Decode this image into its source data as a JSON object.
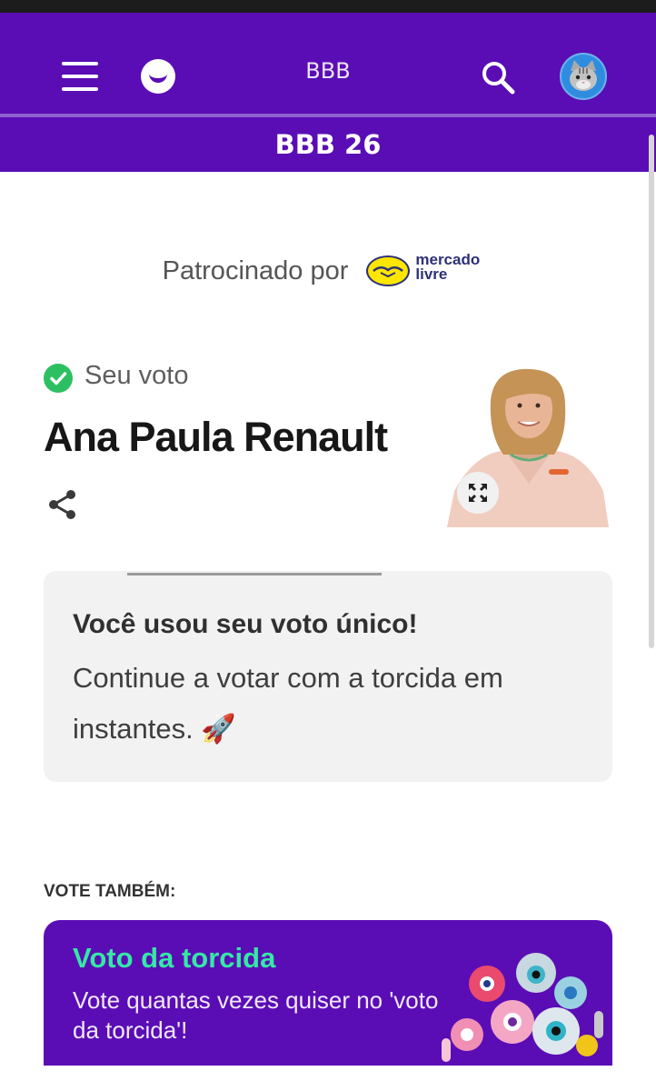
{
  "header": {
    "title": "BBB",
    "section_title": "BBB 26"
  },
  "sponsor": {
    "label": "Patrocinado por",
    "brand_line1": "mercado",
    "brand_line2": "livre"
  },
  "vote": {
    "status_label": "Seu voto",
    "candidate_name": "Ana Paula Renault"
  },
  "notice": {
    "title": "Você usou seu voto único!",
    "body": "Continue a votar com a torcida em instantes. 🚀"
  },
  "vote_also": {
    "heading": "VOTE TAMBÉM:",
    "card_title": "Voto da torcida",
    "card_description": "Vote quantas vezes quiser no 'voto da torcida'!"
  },
  "colors": {
    "brand_purple": "#5a0db5",
    "accent_green": "#35e8a6",
    "check_green": "#2cc062"
  },
  "icons": {
    "menu": "hamburger-icon",
    "logo": "smile-logo-icon",
    "search": "search-icon",
    "avatar": "cat-avatar-icon",
    "status": "check-circle-icon",
    "share": "share-icon",
    "expand": "expand-icon",
    "card_art": "eyes-characters-illustration"
  }
}
